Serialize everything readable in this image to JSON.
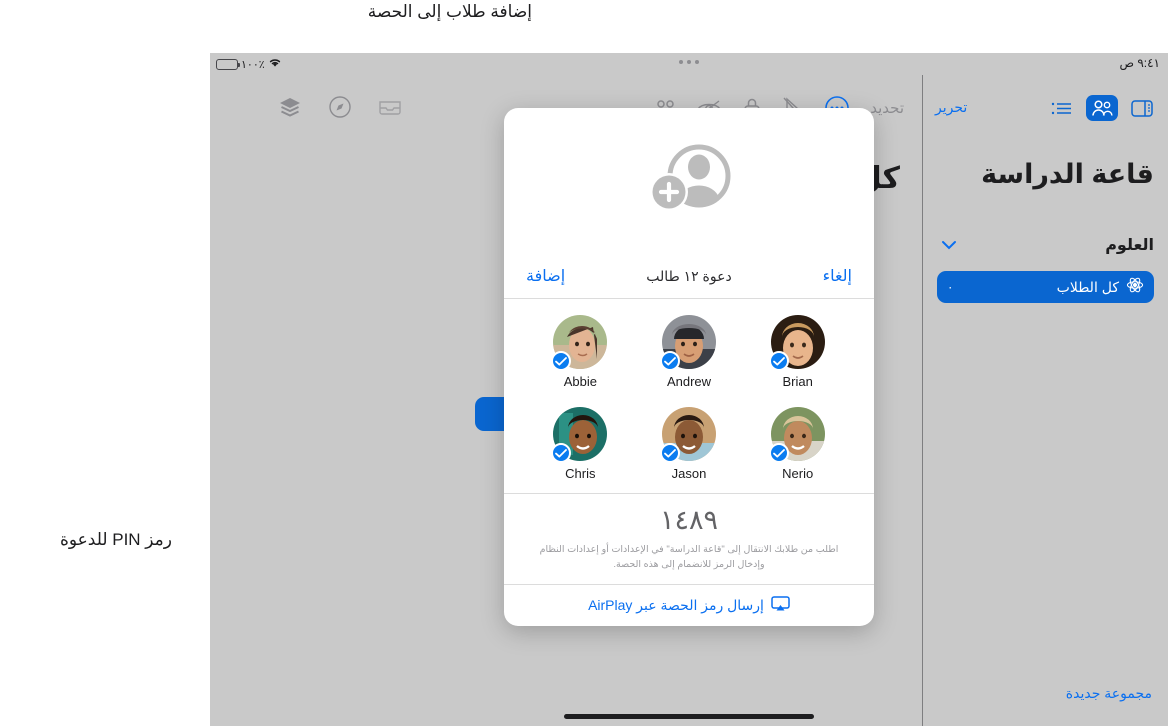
{
  "callouts": [
    {
      "id": "add-students",
      "text": "إضافة طلاب إلى الحصة"
    },
    {
      "id": "invite-pin",
      "text": "رمز PIN للدعوة"
    }
  ],
  "status_bar": {
    "time": "٩:٤١ ص",
    "battery_percent": "٪١٠٠",
    "battery_icon": "battery-full-icon",
    "wifi_icon": "wifi-icon"
  },
  "multitask_handle_icon": "multitask-dots-icon",
  "main_toolbar": {
    "select_label": "تحديد",
    "icons_right": [
      "ellipsis-circle-icon",
      "pointer-slash-icon",
      "lock-icon",
      "eye-slash-icon",
      "grid-four-dots-icon"
    ],
    "icons_left": [
      "inbox-tray-icon",
      "safari-compass-icon",
      "layers-stack-icon"
    ]
  },
  "background": {
    "heading": "كل الطلاب",
    "chip_color": "#0a66d0"
  },
  "sidebar": {
    "edit_label": "تحرير",
    "title": "قاعة الدراسة",
    "toolbar_icons": [
      {
        "name": "sidebar-panel-icon",
        "selected": false
      },
      {
        "name": "two-people-icon",
        "selected": true
      },
      {
        "name": "list-bullet-icon",
        "selected": false
      }
    ],
    "group": {
      "label": "العلوم",
      "chevron_icon": "chevron-down-icon"
    },
    "selected_item": {
      "label": "كل الطلاب",
      "icon": "atom-icon",
      "count": "٠"
    },
    "new_group_label": "مجموعة جديدة"
  },
  "invite_sheet": {
    "hero_icon": "person-badge-plus-icon",
    "add_label": "إضافة",
    "cancel_label": "إلغاء",
    "title": "دعوة ١٢ طالب",
    "students": [
      {
        "name": "Brian",
        "selected": true
      },
      {
        "name": "Andrew",
        "selected": true
      },
      {
        "name": "Abbie",
        "selected": true
      },
      {
        "name": "Nerio",
        "selected": true
      },
      {
        "name": "Jason",
        "selected": true
      },
      {
        "name": "Chris",
        "selected": true
      }
    ],
    "pin_code": "١٤٨٩",
    "pin_caption": "اطلب من طلابك الانتقال إلى \"قاعة الدراسة\" في الإعدادات أو إعدادات النظام وإدخال الرمز للانضمام إلى هذه الحصة.",
    "airplay": {
      "label": "إرسال رمز الحصة عبر AirPlay",
      "icon": "airplay-icon"
    }
  },
  "colors": {
    "accent_blue": "#0a6ff0",
    "selected_blue": "#0a66d0",
    "canvas_gray": "#c9c9c9"
  }
}
